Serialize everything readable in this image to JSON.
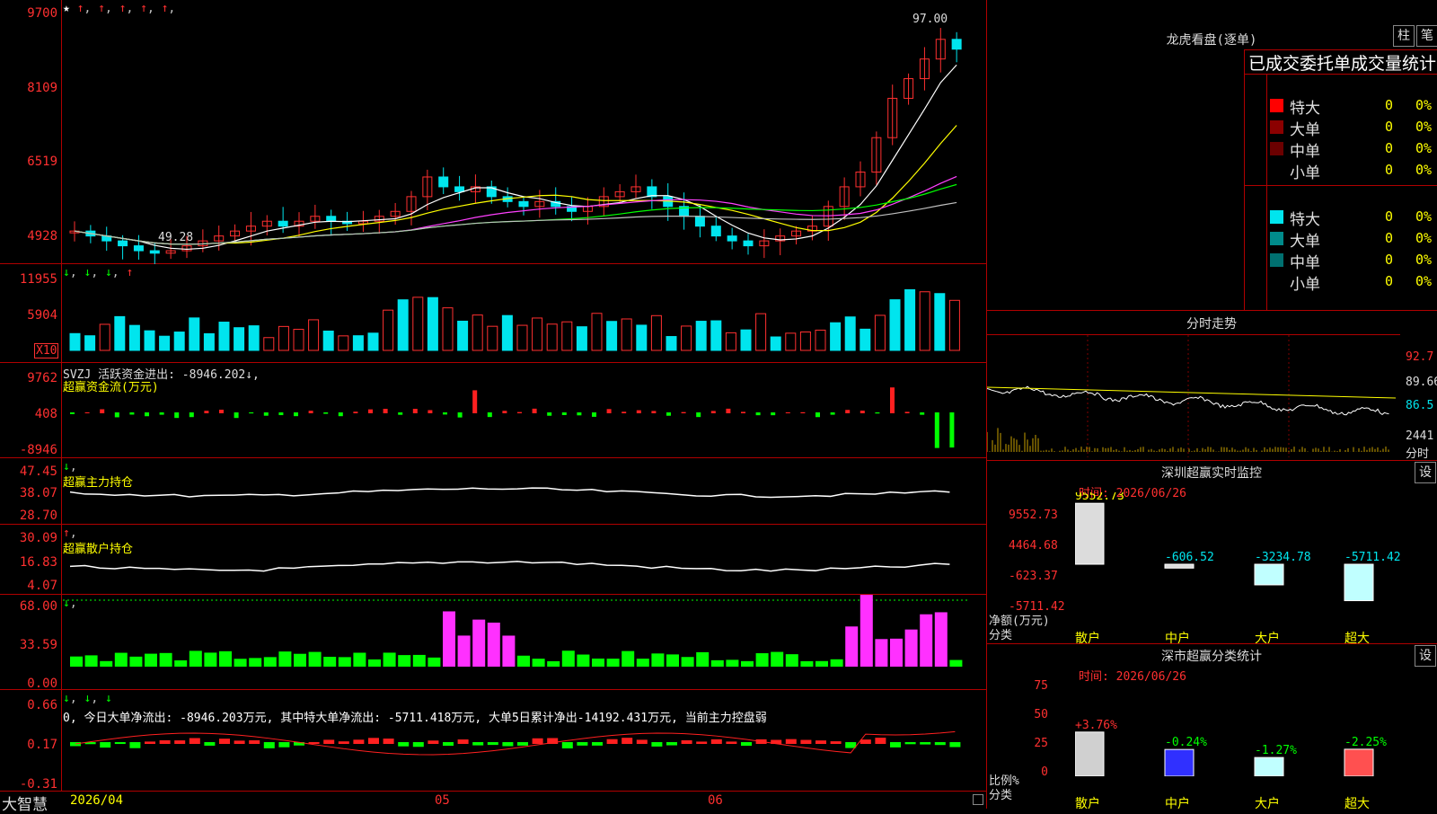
{
  "header": {
    "y_ticks": [
      "9700",
      "8109",
      "6519",
      "4928"
    ],
    "high_label": "97.00",
    "low_label": "49.28"
  },
  "vol": {
    "y_ticks": [
      "11955",
      "5904"
    ],
    "x10": "X10"
  },
  "svzj": {
    "title": "SVZJ  活跃资金进出: -8946.202↓,",
    "sub": "超赢资金流(万元)",
    "y_ticks": [
      "9762",
      "408",
      "-8946"
    ]
  },
  "svzl": {
    "sub": "超赢主力持仓",
    "y_ticks": [
      "47.45",
      "38.07",
      "28.70"
    ]
  },
  "svsh": {
    "sub": "超赢散户持仓",
    "y_ticks": [
      "30.09",
      "16.83",
      "4.07"
    ]
  },
  "ai1": {
    "y_ticks": [
      "68.00",
      "33.59",
      "0.00"
    ]
  },
  "ai2": {
    "line2": "0, 今日大单净流出: -8946.203万元, 其中特大单净流出: -5711.418万元, 大单5日累计净出-14192.431万元, 当前主力控盘弱",
    "y_ticks": [
      "0.66",
      "0.17",
      "-0.31"
    ]
  },
  "bottom": {
    "brand": "大智慧",
    "date": "2026/04",
    "month1": "05",
    "month2": "06"
  },
  "right": {
    "lhb_title": "龙虎看盘(逐单)",
    "btn_zhu": "柱",
    "btn_bi": "笔",
    "trade_title": "已成交委托单成交量统计",
    "buy": {
      "rows": [
        {
          "label": "特大",
          "val": "0",
          "pct": "0%",
          "color": "#ff0000"
        },
        {
          "label": "大单",
          "val": "0",
          "pct": "0%",
          "color": "#8b0000"
        },
        {
          "label": "中单",
          "val": "0",
          "pct": "0%",
          "color": "#6b0000"
        },
        {
          "label": "小单",
          "val": "0",
          "pct": "0%",
          "color": "#000000"
        }
      ]
    },
    "sell": {
      "rows": [
        {
          "label": "特大",
          "val": "0",
          "pct": "0%",
          "color": "#00e5ee"
        },
        {
          "label": "大单",
          "val": "0",
          "pct": "0%",
          "color": "#008b8b"
        },
        {
          "label": "中单",
          "val": "0",
          "pct": "0%",
          "color": "#007070"
        },
        {
          "label": "小单",
          "val": "0",
          "pct": "0%",
          "color": "#000000"
        }
      ]
    },
    "fs_title": "分时走势",
    "fs_right": [
      "92.7",
      "89.66",
      "86.5",
      "2441",
      "分时"
    ],
    "sz_title": "深圳超赢实时监控",
    "set": "设",
    "sz_time": "时间: 2026/06/26",
    "sz_y": [
      "9552.73",
      "4464.68",
      "-623.37",
      "-5711.42"
    ],
    "sz_vals": [
      "9552.73",
      "-606.52",
      "-3234.78",
      "-5711.42"
    ],
    "sz_ylab1": "净额(万元)",
    "sz_ylab2": "分类",
    "cats": [
      "散户",
      "中户",
      "大户",
      "超大"
    ],
    "fl_title": "深市超赢分类统计",
    "fl_time": "时间: 2026/06/26",
    "fl_y": [
      "75",
      "50",
      "25",
      "0"
    ],
    "fl_pct": [
      "+3.76%",
      "-0.24%",
      "-1.27%",
      "-2.25%"
    ],
    "fl_vals": [
      "37.83",
      "22.95",
      "16.07",
      "23.15"
    ],
    "fl_ylab1": "比例%",
    "fl_ylab2": "分类"
  }
}
